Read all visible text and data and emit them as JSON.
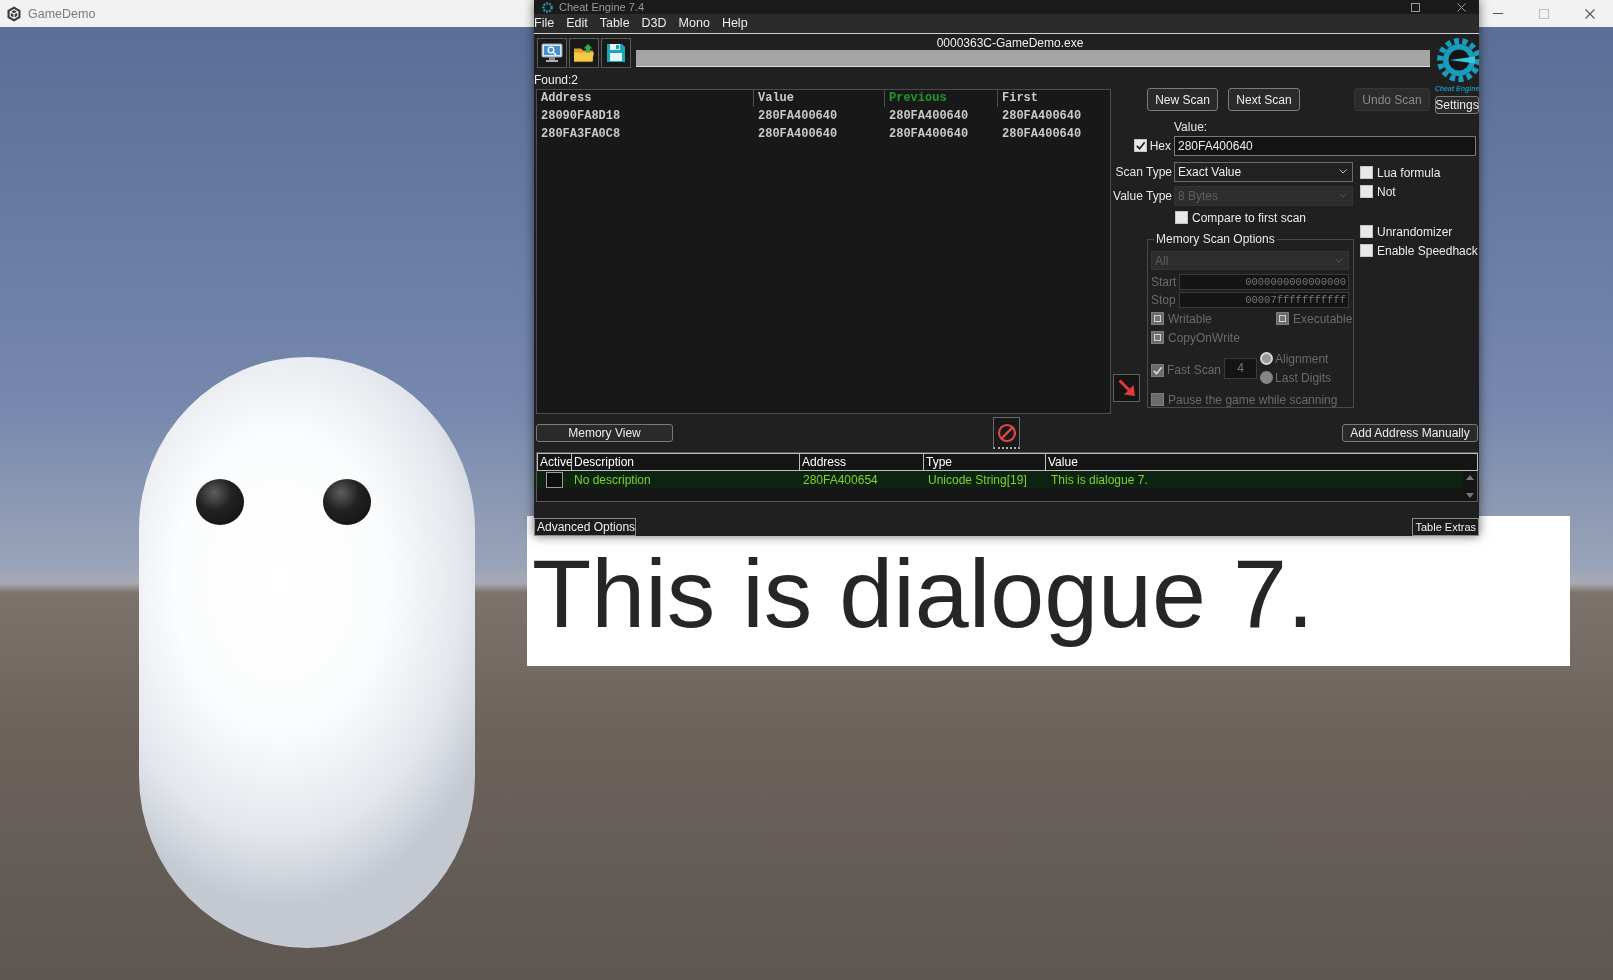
{
  "game": {
    "title": "GameDemo",
    "dialogue": "This is dialogue 7."
  },
  "cheat_engine": {
    "title": "Cheat Engine 7.4",
    "menu": [
      "File",
      "Edit",
      "Table",
      "D3D",
      "Mono",
      "Help"
    ],
    "process": "0000363C-GameDemo.exe",
    "progress": {
      "level": 0
    },
    "logo_caption": "Cheat Engine",
    "found": "Found:2",
    "results": {
      "columns": [
        {
          "label": "Address",
          "highlighted": false
        },
        {
          "label": "Value",
          "highlighted": false
        },
        {
          "label": "Previous",
          "highlighted": true
        },
        {
          "label": "First",
          "highlighted": false
        }
      ],
      "rows": [
        [
          "28090FA8D18",
          "280FA400640",
          "280FA400640",
          "280FA400640"
        ],
        [
          "280FA3FA0C8",
          "280FA400640",
          "280FA400640",
          "280FA400640"
        ]
      ]
    },
    "scan_buttons": [
      {
        "label": "New Scan",
        "disabled": false
      },
      {
        "label": "Next Scan",
        "disabled": false
      },
      {
        "label": "Undo Scan",
        "disabled": true
      }
    ],
    "settings_button": "Settings",
    "value": {
      "label": "Value:",
      "hex": {
        "label": "Hex",
        "checked": true
      },
      "text": "280FA400640"
    },
    "scan_type": {
      "label": "Scan Type",
      "value": "Exact Value",
      "disabled": false
    },
    "value_type": {
      "label": "Value Type",
      "value": "8 Bytes",
      "disabled": true
    },
    "compare_first": {
      "label": "Compare to first scan",
      "checked": false
    },
    "scan_options": [
      {
        "label": "Lua formula",
        "checked": false
      },
      {
        "label": "Not",
        "checked": false
      }
    ],
    "extra_options": [
      {
        "label": "Unrandomizer",
        "checked": false
      },
      {
        "label": "Enable Speedhack",
        "checked": false
      }
    ],
    "memory_scan_options": {
      "title": "Memory Scan Options",
      "disabled": true,
      "region": "All",
      "start": {
        "label": "Start",
        "value": "0000000000000000"
      },
      "stop": {
        "label": "Stop",
        "value": "00007fffffffffff"
      },
      "protection": [
        {
          "label": "Writable",
          "indeterminate": true
        },
        {
          "label": "Executable",
          "indeterminate": true
        },
        {
          "label": "CopyOnWrite",
          "indeterminate": true
        }
      ],
      "fast_scan": {
        "label": "Fast Scan",
        "checked": true,
        "value": "4"
      },
      "alignment": [
        {
          "label": "Alignment",
          "selected": true
        },
        {
          "label": "Last Digits",
          "selected": false
        }
      ],
      "pause": {
        "label": "Pause the game while scanning",
        "checked": false
      }
    },
    "memory_view_button": "Memory View",
    "add_address_button": "Add Address Manually",
    "address_list": {
      "columns": [
        "Active",
        "Description",
        "Address",
        "Type",
        "Value"
      ],
      "rows": [
        {
          "active": false,
          "selected": true,
          "description": "No description",
          "address": "280FA400654",
          "type": "Unicode String[19]",
          "value": "This is dialogue 7."
        }
      ]
    },
    "advanced_options_button": "Advanced Options",
    "table_extras_button": "Table Extras"
  }
}
